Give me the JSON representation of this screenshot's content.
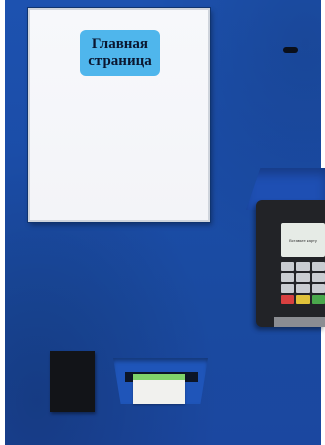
{
  "screen": {
    "home_button_label": "Главная\nстраница"
  },
  "terminal": {
    "screen_text": "Вставьте карту"
  },
  "colors": {
    "panel": "#1b4da8",
    "home_button": "#4fb6ec",
    "receipt_accent": "#7fd36a"
  }
}
